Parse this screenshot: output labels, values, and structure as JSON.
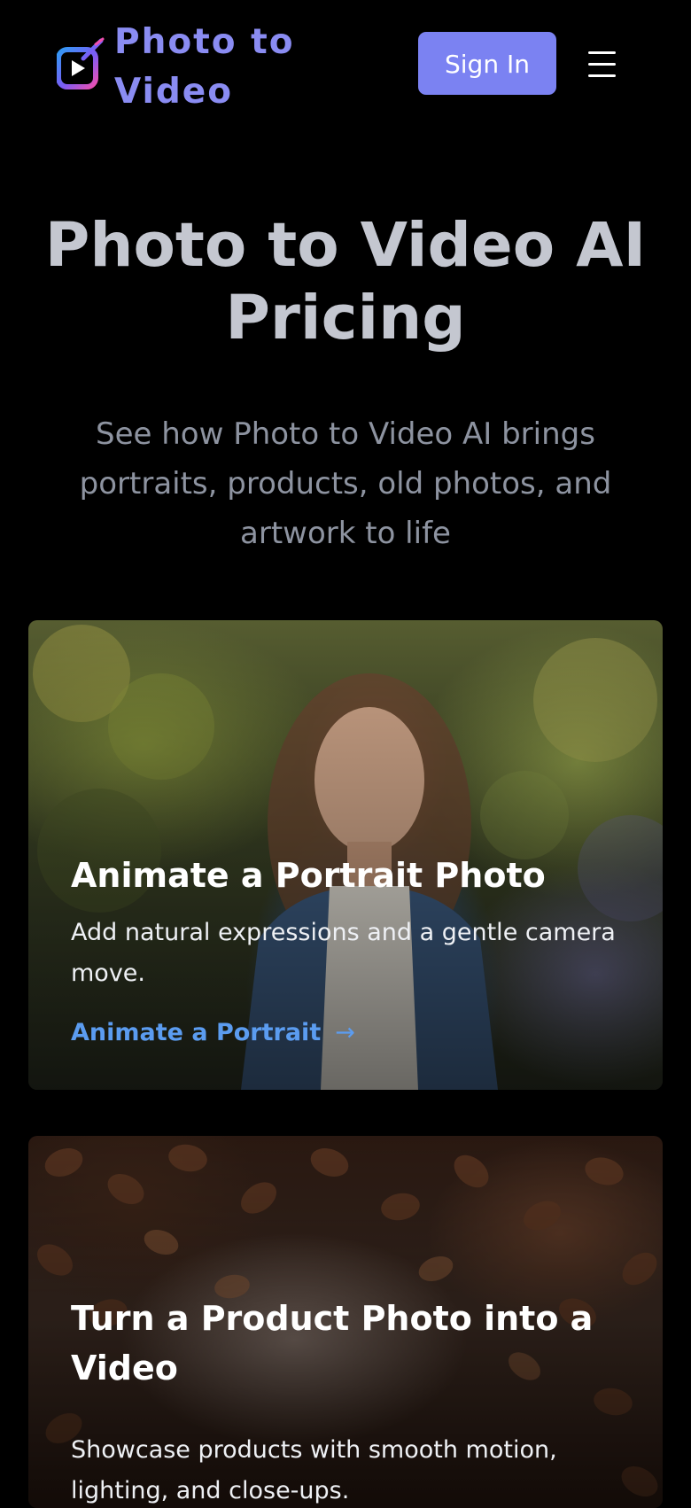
{
  "header": {
    "logo_text_line1": "Photo to",
    "logo_text_line2": "Video",
    "logo_icon": "play-sparkle-icon",
    "sign_in_label": "Sign In",
    "menu_icon": "hamburger-menu-icon"
  },
  "hero": {
    "title_line1": "Photo to Video AI",
    "title_line2": "Pricing",
    "subtitle_line1": "See how Photo to Video AI brings",
    "subtitle_line2": "portraits, products, old photos, and",
    "subtitle_line3": "artwork to life"
  },
  "cards": [
    {
      "title": "Animate a Portrait Photo",
      "description_line1": "Add natural expressions and a gentle camera",
      "description_line2": "move.",
      "link_label": "Animate a Portrait",
      "link_arrow": "→",
      "image_subject": "portrait-woman-garden"
    },
    {
      "title_line1": "Turn a Product Photo into a",
      "title_line2": "Video",
      "description_line1": "Showcase products with smooth motion,",
      "description_line2": "lighting, and close-ups.",
      "image_subject": "coffee-beans"
    }
  ],
  "colors": {
    "background": "#000000",
    "brand": "#8a8cf2",
    "sign_in_bg": "#7b82f2",
    "link": "#5b9cf0",
    "hero_title": "#c4c7d0",
    "hero_subtitle": "#8d93a0"
  }
}
